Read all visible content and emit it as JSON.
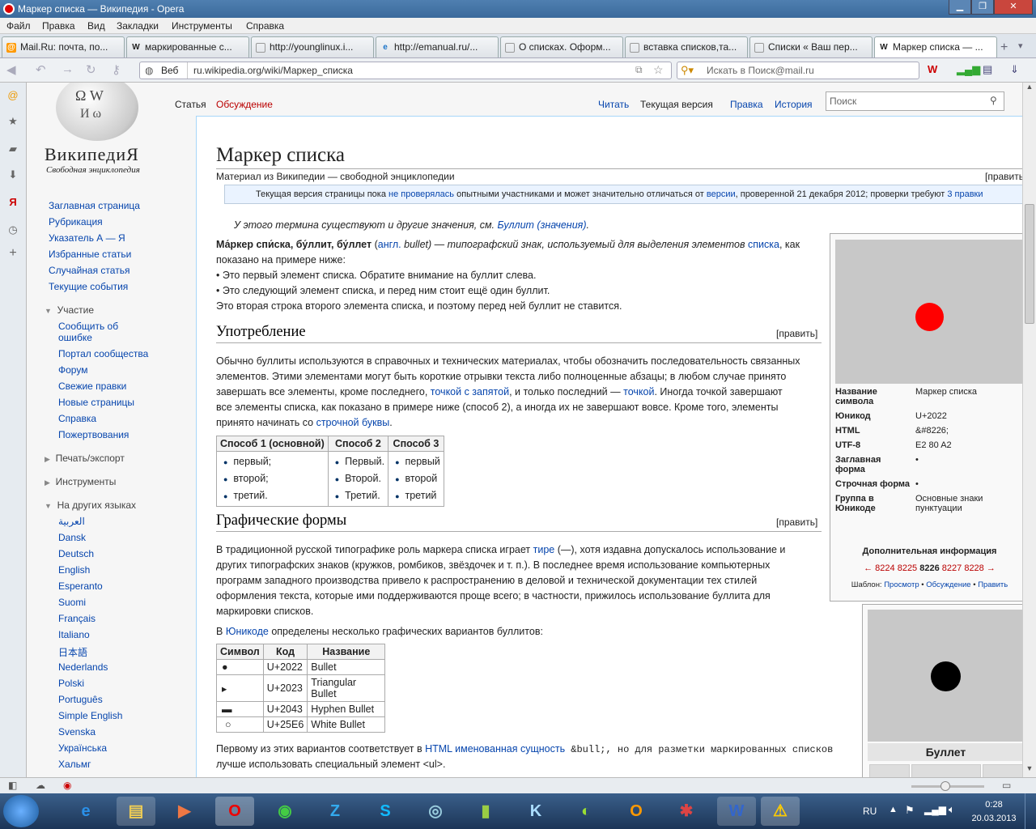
{
  "window": {
    "title": "Маркер списка — Википедия - Opera"
  },
  "menu": [
    "Файл",
    "Правка",
    "Вид",
    "Закладки",
    "Инструменты",
    "Справка"
  ],
  "tabs": [
    "Mail.Ru: почта, по...",
    "маркированные с...",
    "http://younglinux.i...",
    "http://emanual.ru/...",
    "О списках. Оформ...",
    "вставка списков,та...",
    "Списки « Ваш пер...",
    "Маркер списка — ..."
  ],
  "address": {
    "label": "Веб",
    "url": "ru.wikipedia.org/wiki/Маркер_списка",
    "search_placeholder": "Искать в Поиск@mail.ru"
  },
  "wiki": {
    "logo_title": "ВикипедиЯ",
    "logo_sub": "Свободная энциклопедия",
    "search_placeholder": "Поиск",
    "nav": [
      "Заглавная страница",
      "Рубрикация",
      "Указатель А — Я",
      "Избранные статьи",
      "Случайная статья",
      "Текущие события"
    ],
    "participate_head": "Участие",
    "participate": [
      "Сообщить об ошибке",
      "Портал сообщества",
      "Форум",
      "Свежие правки",
      "Новые страницы",
      "Справка",
      "Пожертвования"
    ],
    "print_head": "Печать/экспорт",
    "tools_head": "Инструменты",
    "langs_head": "На других языках",
    "langs": [
      "العربية",
      "Dansk",
      "Deutsch",
      "English",
      "Esperanto",
      "Suomi",
      "Français",
      "Italiano",
      "日本語",
      "Nederlands",
      "Polski",
      "Português",
      "Simple English",
      "Svenska",
      "Українська",
      "Хальмг"
    ],
    "tab_article": "Статья",
    "tab_talk": "Обсуждение",
    "tab_read": "Читать",
    "tab_current": "Текущая версия",
    "tab_edit": "Правка",
    "tab_history": "История",
    "title": "Маркер списка",
    "subtitle": "Материал из Википедии — свободной энциклопедии",
    "edit": "[править]",
    "notice_a": "Текущая версия страницы пока ",
    "notice_link1": "не проверялась",
    "notice_b": " опытными участниками и может значительно отличаться от ",
    "notice_link2": "версии",
    "notice_c": ", проверенной 21 декабря 2012; проверки требуют ",
    "notice_link3": "3 правки",
    "hatnote_a": "У этого термина существуют и другие значения, см. ",
    "hatnote_link": "Буллит (значения)",
    "intro_bold": "Ма́ркер спи́ска, бу́ллит, бу́ллет",
    "intro_a": " (",
    "intro_lang": "англ.",
    "intro_b": " bullet) — типографский знак, используемый для выделения элементов ",
    "intro_link": "списка",
    "intro_c": ", как",
    "intro_line2": "показано на примере ниже:",
    "intro_item1": "• Это первый элемент списка. Обратите внимание на буллит слева.",
    "intro_item2": "• Это следующий элемент списка, и перед ним стоит ещё один буллит.",
    "intro_item3": "Это вторая строка второго элемента списка, и поэтому перед ней буллит не ставится.",
    "h_usage": "Употребление",
    "usage_l1": "Обычно буллиты используются в справочных и технических материалах, чтобы обозначить последовательность связанных",
    "usage_l2": "элементов. Этими элементами могут быть короткие отрывки текста либо полноценные абзацы; в любом случае принято",
    "usage_l3a": "завершать все элементы, кроме последнего, ",
    "usage_l3link": "точкой с запятой",
    "usage_l3b": ", и только последний — ",
    "usage_l3link2": "точкой",
    "usage_l3c": ". Иногда точкой завершают",
    "usage_l4": "все элементы списка, как показано в примере ниже (способ 2), а иногда их не завершают вовсе. Кроме того, элементы",
    "usage_l5a": "принято начинать со ",
    "usage_l5link": "строчной буквы",
    "methods": {
      "headers": [
        "Способ 1 (основной)",
        "Способ 2",
        "Способ 3"
      ],
      "cols": [
        [
          "первый;",
          "второй;",
          "третий."
        ],
        [
          "Первый.",
          "Второй.",
          "Третий."
        ],
        [
          "первый",
          "второй",
          "третий"
        ]
      ]
    },
    "h_forms": "Графические формы",
    "forms_l1a": "В традиционной русской типографике роль маркера списка играет ",
    "forms_l1link": "тире",
    "forms_l1b": " (—), хотя издавна допускалось использование и",
    "forms_l2": "других типографских знаков (кружков, ромбиков, звёздочек и т. п.). В последнее время использование компьютерных",
    "forms_l3": "программ западного производства привело к распространению в деловой и технической документации тех стилей",
    "forms_l4": "оформления текста, которые ими поддерживаются проще всего; в частности, прижилось использование буллита для",
    "forms_l5": "маркировки списков.",
    "forms_l6a": "В ",
    "forms_l6link": "Юникоде",
    "forms_l6b": " определены несколько графических вариантов буллитов:",
    "unicode": {
      "headers": [
        "Символ",
        "Код",
        "Название"
      ],
      "rows": [
        [
          "●",
          "U+2022",
          "Bullet"
        ],
        [
          "▸",
          "U+2023",
          "Triangular Bullet"
        ],
        [
          "▬",
          "U+2043",
          "Hyphen Bullet"
        ],
        [
          "○",
          "U+25E6",
          "White Bullet"
        ]
      ]
    },
    "last_l1a": "Первому из этих вариантов соответствует в ",
    "last_l1link": "HTML именованная сущность",
    "last_l1b": " &bull;, но для разметки маркированных списков",
    "last_l2": "лучше использовать специальный элемент <ul>.",
    "infobox": {
      "rows": [
        [
          "Название символа",
          "Маркер списка"
        ],
        [
          "Юникод",
          "U+2022"
        ],
        [
          "HTML",
          "&#8226;"
        ],
        [
          "UTF-8",
          "E2 80 A2"
        ],
        [
          "Заглавная форма",
          "•"
        ],
        [
          "Строчная форма",
          "•"
        ],
        [
          "Группа в Юникоде",
          "Основные знаки пунктуации"
        ]
      ],
      "extra": "Дополнительная информация",
      "codes": [
        "← 8224 8225",
        "8226",
        "8227 8228 →"
      ],
      "tpl_a": "Шаблон: ",
      "tpl_links": [
        "Просмотр",
        "Обсуждение",
        "Править"
      ]
    },
    "infobox2": {
      "caption": "Буллет"
    }
  },
  "taskbar": {
    "lang": "RU",
    "time": "0:28",
    "date": "20.03.2013"
  }
}
